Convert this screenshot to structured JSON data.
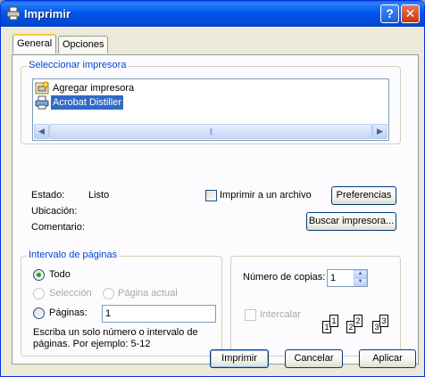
{
  "window": {
    "title": "Imprimir",
    "help_glyph": "?",
    "close_glyph": "✕"
  },
  "tabs": [
    {
      "label": "General"
    },
    {
      "label": "Opciones"
    }
  ],
  "select_printer": {
    "group_label": "Seleccionar impresora",
    "items": [
      {
        "label": "Agregar impresora",
        "icon": "add-printer-icon"
      },
      {
        "label": "Acrobat Distiller",
        "icon": "printer-icon"
      }
    ],
    "scroll_left": "◀",
    "scroll_right": "▶",
    "thumb_grip": "|||"
  },
  "status": {
    "estado_label": "Estado:",
    "estado_value": "Listo",
    "ubicacion_label": "Ubicación:",
    "ubicacion_value": "",
    "comentario_label": "Comentario:",
    "comentario_value": ""
  },
  "print_to_file": {
    "label": "Imprimir a un archivo",
    "checked": false
  },
  "buttons": {
    "preferencias": "Preferencias",
    "buscar": "Buscar impresora...",
    "imprimir": "Imprimir",
    "cancelar": "Cancelar",
    "aplicar": "Aplicar"
  },
  "page_range": {
    "group_label": "Intervalo de páginas",
    "todo": "Todo",
    "seleccion": "Selección",
    "pagina_actual": "Página actual",
    "paginas": "Páginas:",
    "paginas_value": "1",
    "hint_line1": "Escriba un solo número o intervalo de",
    "hint_line2": "páginas. Por ejemplo: 5-12",
    "selected": "Todo"
  },
  "copies": {
    "label": "Número de copias:",
    "value": "1",
    "intercalar": "Intercalar",
    "spin_up": "▲",
    "spin_down": "▼"
  }
}
